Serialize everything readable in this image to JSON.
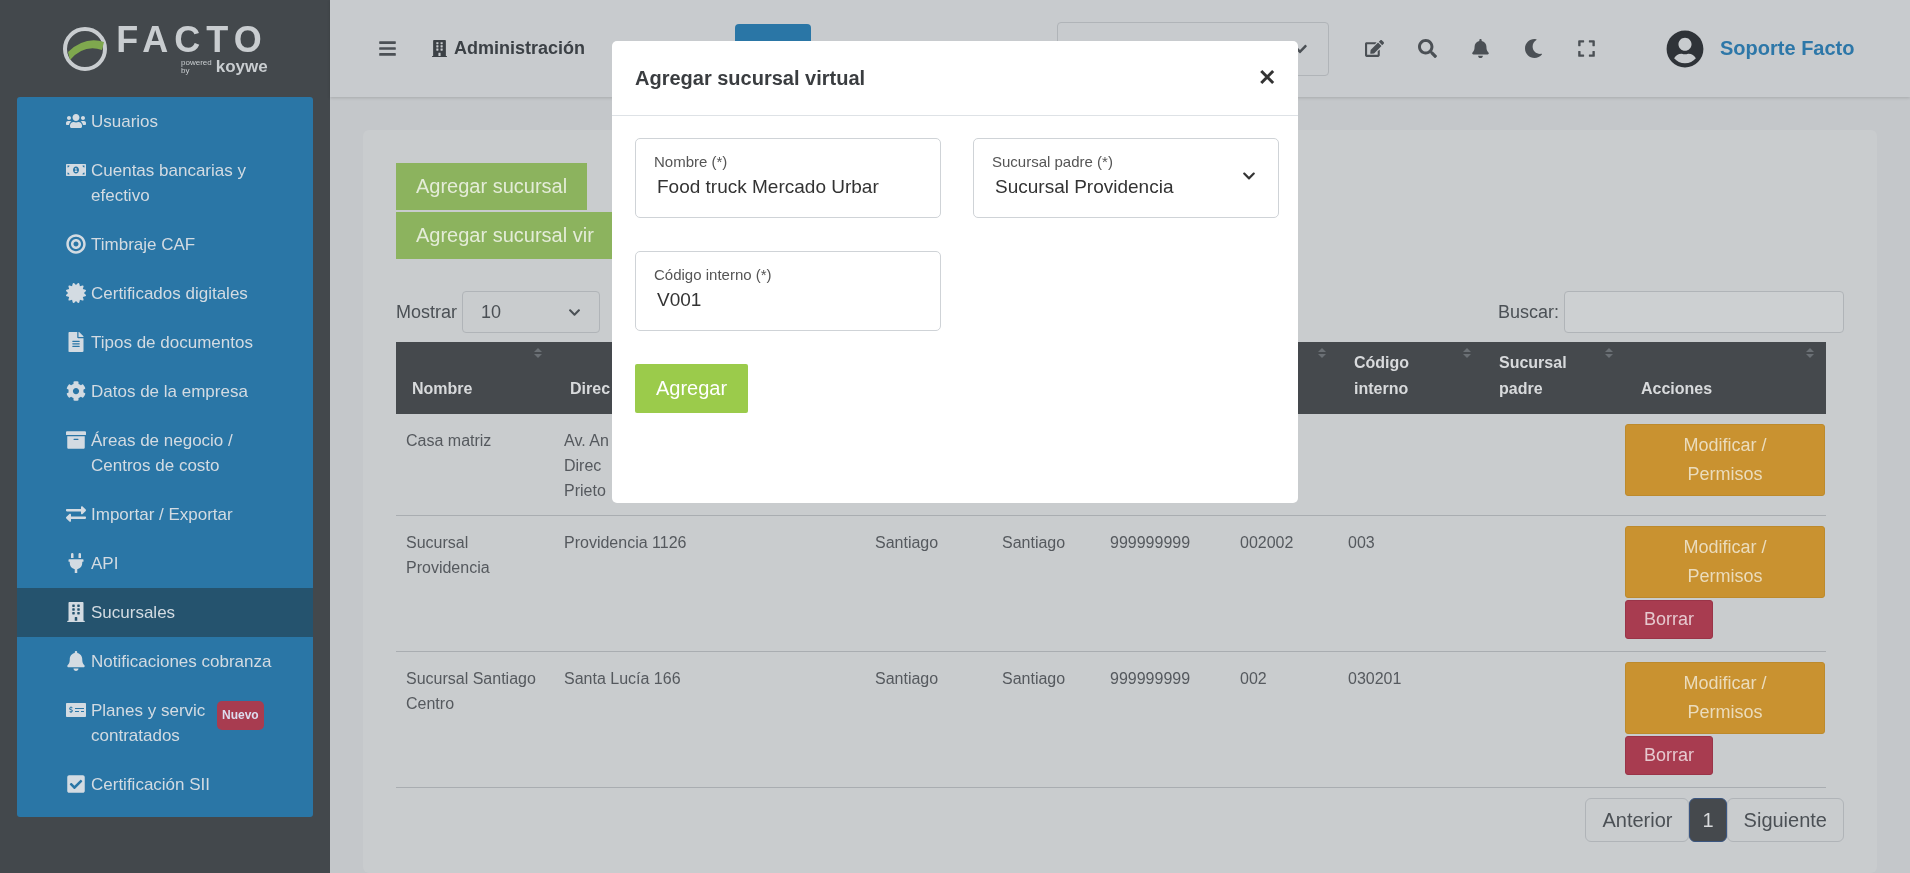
{
  "logo": {
    "name": "FACTO",
    "powered": "powered",
    "by": "by",
    "brand": "koywe"
  },
  "sidebar": {
    "items": [
      {
        "label": "Usuarios",
        "selected": false
      },
      {
        "label": "Cuentas bancarias y efectivo",
        "selected": false
      },
      {
        "label": "Timbraje CAF",
        "selected": false
      },
      {
        "label": "Certificados digitales",
        "selected": false
      },
      {
        "label": "Tipos de documentos",
        "selected": false
      },
      {
        "label": "Datos de la empresa",
        "selected": false
      },
      {
        "label": "Áreas de negocio / Centros de costo",
        "selected": false
      },
      {
        "label": "Importar / Exportar",
        "selected": false
      },
      {
        "label": "API",
        "selected": false
      },
      {
        "label": "Sucursales",
        "selected": true
      },
      {
        "label": "Notificaciones cobranza",
        "selected": false
      },
      {
        "label": "Planes y servic\ncontratados",
        "selected": false,
        "badge": "Nuevo"
      },
      {
        "label": "Certificación SII",
        "selected": false
      }
    ]
  },
  "topbar": {
    "section": "Administración",
    "user": "Soporte Facto"
  },
  "actions": [
    {
      "label": "Agregar sucursal"
    },
    {
      "label": "Agregar sucursal vir"
    }
  ],
  "show": {
    "label": "Mostrar",
    "value": "10"
  },
  "search": {
    "label": "Buscar:"
  },
  "table": {
    "columns": [
      {
        "label": "Nombre",
        "sort": true
      },
      {
        "label": "Direc",
        "sort": false
      },
      {},
      {},
      {},
      {
        "sort": true
      },
      {
        "label": "Código interno",
        "sort": true
      },
      {
        "label": "Sucursal padre",
        "sort": true
      },
      {
        "label": "Acciones",
        "sort": true
      }
    ],
    "rows": [
      {
        "cells": [
          "Casa matriz",
          "Av. An\nDirec\nPrieto",
          null,
          null,
          null,
          null,
          null,
          null
        ],
        "actions": [
          {
            "kind": "modify",
            "label": "Modificar / Permisos"
          }
        ]
      },
      {
        "cells": [
          "Sucursal Providencia",
          "Providencia 1126",
          "Santiago",
          "Santiago",
          "999999999",
          "002002",
          "003",
          null
        ],
        "actions": [
          {
            "kind": "modify",
            "label": "Modificar / Permisos"
          },
          {
            "kind": "delete",
            "label": "Borrar"
          }
        ]
      },
      {
        "cells": [
          "Sucursal Santiago Centro",
          "Santa Lucía 166",
          "Santiago",
          "Santiago",
          "999999999",
          "002",
          "030201",
          null
        ],
        "actions": [
          {
            "kind": "modify",
            "label": "Modificar / Permisos"
          },
          {
            "kind": "delete",
            "label": "Borrar"
          }
        ]
      }
    ]
  },
  "pagination": {
    "previous": "Anterior",
    "pages": [
      {
        "label": "1",
        "selected": true
      }
    ],
    "next": "Siguiente"
  },
  "modal": {
    "title": "Agregar sucursal virtual",
    "close": "✕",
    "fields": [
      {
        "kind": "text",
        "label": "Nombre (*)",
        "value": "Food truck Mercado Urbar"
      },
      {
        "kind": "select",
        "label": "Sucursal padre (*)",
        "value": "Sucursal Providencia"
      },
      {
        "kind": "text",
        "label": "Código interno (*)",
        "value": "V001"
      }
    ],
    "submit": "Agregar"
  }
}
